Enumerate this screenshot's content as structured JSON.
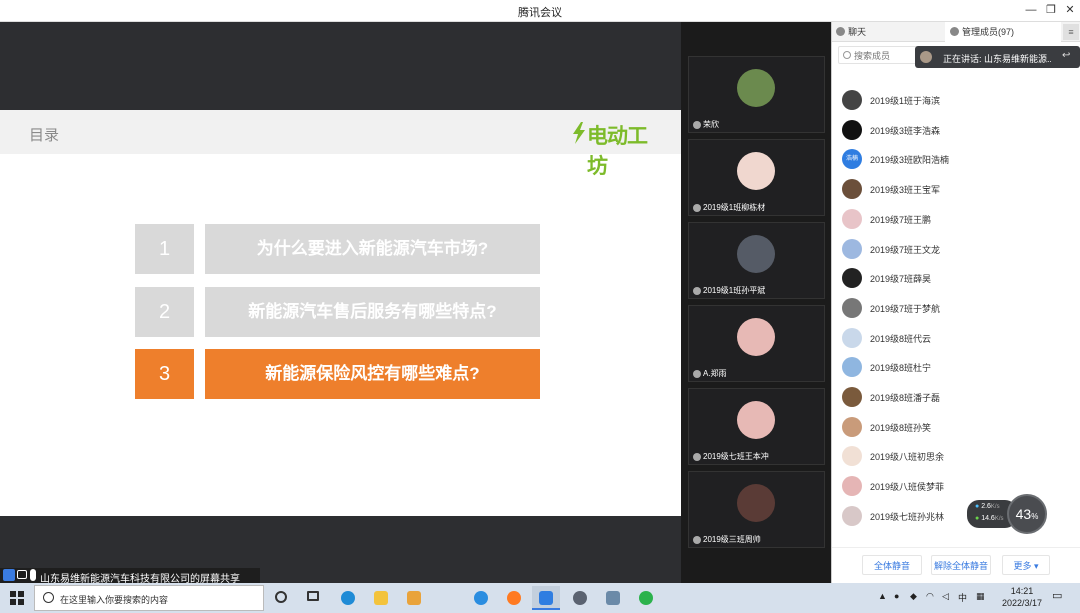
{
  "window": {
    "title": "腾讯会议"
  },
  "slide": {
    "title": "目录",
    "logo_text": "电动工坊",
    "items": [
      {
        "num": "1",
        "text": "为什么要进入新能源汽车市场?"
      },
      {
        "num": "2",
        "text": "新能源汽车售后服务有哪些特点?"
      },
      {
        "num": "3",
        "text": "新能源保险风控有哪些难点?"
      }
    ]
  },
  "videos": [
    {
      "name": "荣欣"
    },
    {
      "name": "2019级1班柳栋材"
    },
    {
      "name": "2019级1班孙平斌"
    },
    {
      "name": "A.郑雨"
    },
    {
      "name": "2019级七班王本冲"
    },
    {
      "name": "2019级三班周帅"
    }
  ],
  "panel": {
    "tab_chat": "聊天",
    "tab_members": "管理成员(97)",
    "search_placeholder": "搜索成员",
    "speaking": "正在讲话: 山东易维新能源...",
    "members": [
      {
        "name": "2019级1班于海滨",
        "color": "#444"
      },
      {
        "name": "2019级3班李浩森",
        "color": "#111"
      },
      {
        "name": "2019级3班欧阳浩楠",
        "color": "#2f7de1",
        "ava_text": "浩楠"
      },
      {
        "name": "2019级3班王宝军",
        "color": "#6b4f3a"
      },
      {
        "name": "2019级7班王鹏",
        "color": "#e8c4c8"
      },
      {
        "name": "2019级7班王文龙",
        "color": "#9db8e0"
      },
      {
        "name": "2019级7班薛昊",
        "color": "#222"
      },
      {
        "name": "2019级7班于梦航",
        "color": "#777"
      },
      {
        "name": "2019级8班代云",
        "color": "#c9d8ea"
      },
      {
        "name": "2019级8班杜宁",
        "color": "#8fb6e0"
      },
      {
        "name": "2019级8班潘子磊",
        "color": "#7a5a3c"
      },
      {
        "name": "2019级8班孙笑",
        "color": "#c99b7a"
      },
      {
        "name": "2019级八班初思余",
        "color": "#f1e0d5"
      },
      {
        "name": "2019级八班侯梦菲",
        "color": "#e5b5b5"
      },
      {
        "name": "2019级七班孙兆林",
        "color": "#d8c8c8"
      }
    ],
    "btn_mute_all": "全体静音",
    "btn_unmute_all": "解除全体静音",
    "btn_more": "更多"
  },
  "netspeed": {
    "up": "2.6",
    "down": "14.6",
    "unit": "K/s",
    "percent": "43",
    "percent_unit": "%"
  },
  "sharebar": {
    "text": "山东易维新能源汽车科技有限公司的屏幕共享"
  },
  "taskbar": {
    "search_placeholder": "在这里输入你要搜索的内容",
    "ime": "中",
    "time": "14:21",
    "date": "2022/3/17"
  }
}
